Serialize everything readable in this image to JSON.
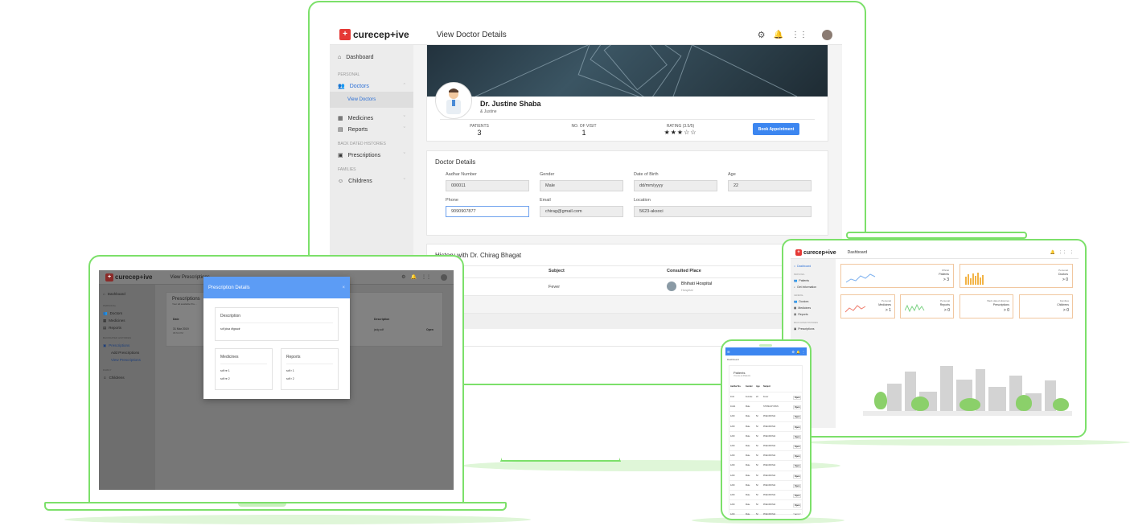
{
  "brand": {
    "name": "curecep+ive",
    "mark": "+"
  },
  "desktop": {
    "page_title": "View Doctor Details",
    "sidebar": {
      "dashboard": "Dashboard",
      "sec_personal": "PERSONAL",
      "doctors": "Doctors",
      "view_doctors": "View Doctors",
      "medicines": "Medicines",
      "reports": "Reports",
      "sec_backdated": "BACK DATED HISTORIES",
      "prescriptions": "Prescriptions",
      "sec_families": "FAMILIES",
      "childrens": "Childrens"
    },
    "profile": {
      "name": "Dr. Justine Shaba",
      "username": "& Justine",
      "patients_label": "PATIENTS",
      "patients_value": "3",
      "visits_label": "NO. OF VISIT",
      "visits_value": "1",
      "rating_label": "RATING (3.5/5)",
      "rating_stars": "★★★☆☆",
      "book_button": "Book Appointment"
    },
    "details": {
      "title": "Doctor Details",
      "aadhar_label": "Aadhar Number",
      "aadhar_value": "000011",
      "gender_label": "Gender",
      "gender_value": "Male",
      "dob_label": "Date of Birth",
      "dob_value": "dd/mm/yyyy",
      "age_label": "Age",
      "age_value": "22",
      "phone_label": "Phone",
      "phone_value": "9090907877",
      "email_label": "Email",
      "email_value": "chirag@gmail.com",
      "location_label": "Location",
      "location_value": "5623-aksoci"
    },
    "history": {
      "title": "History with Dr. Chirag Bhagat",
      "col_subject": "Subject",
      "col_place": "Consulted Place",
      "row_subject": "Fever",
      "row_place": "Bhihati Hospital",
      "row_place_sub": "Hospital"
    }
  },
  "laptop": {
    "page_title": "View Prescriptions",
    "sidebar": {
      "dashboard": "Dashboard",
      "sec_personal": "PERSONAL",
      "doctors": "Doctors",
      "medicines": "Medicines",
      "reports": "Reports",
      "sec_backdated": "BACKDATED HISTORIES",
      "prescriptions": "Prescriptions",
      "add_prescriptions": "Add Prescriptions",
      "view_prescriptions": "View Prescriptions",
      "sec_family": "FAMILY",
      "childrens": "Childrens"
    },
    "panel": {
      "title": "Prescriptions",
      "subtitle": "Your all available Pre...",
      "col_date": "Date",
      "col_description": "Description",
      "row_date": "31 Mar 2019",
      "row_time": "05:54 PM",
      "row_description": "jsdg sdf",
      "row_action": "Open"
    },
    "modal": {
      "title": "Prescription Details",
      "close": "×",
      "description_label": "Description",
      "description_value": "sdf jdsa dfgsadr",
      "medicines_label": "Medicines",
      "medicines": [
        "sdf re 1",
        "sdf re 2"
      ],
      "reports_label": "Reports",
      "reports": [
        "sdf r 1",
        "sdf r 2"
      ]
    }
  },
  "tablet": {
    "page_title": "Dashboard",
    "sidebar": {
      "dashboard": "Dashboard",
      "sec_personal": "PERSONAL",
      "patients": "Patients",
      "get_information": "Get Information",
      "sec_general": "GENERAL",
      "doctors": "Doctors",
      "medicines": "Medicines",
      "reports": "Reports",
      "sec_backdated": "BACK DATED HISTORIES",
      "prescriptions": "Prescriptions"
    },
    "cards": [
      {
        "line1": "Official",
        "line2": "Patients",
        "value": "> 3"
      },
      {
        "line1": "Personal",
        "line2": "Doctors",
        "value": "> 0"
      },
      {
        "line1": "Personal",
        "line2": "Medicines",
        "value": "> 1"
      },
      {
        "line1": "Personal",
        "line2": "Reports",
        "value": "> 0"
      },
      {
        "line1": "Back dated Histories",
        "line2": "Prescriptions",
        "value": "> 0"
      },
      {
        "line1": "Families",
        "line2": "Childrens",
        "value": "> 0"
      }
    ]
  },
  "phone": {
    "breadcrumb": "Dashboard",
    "panel_title": "Patients",
    "panel_subtitle": "You are at Patients",
    "columns": [
      "Aadhar No.",
      "Gender",
      "Age",
      "Subject"
    ],
    "rows": [
      [
        "1111",
        "Female",
        "22",
        "Fever",
        "Open"
      ],
      [
        "11111",
        "Male",
        "",
        "STOMACH PAIN",
        "Open"
      ],
      [
        "1200",
        "Male",
        "52",
        "PNEUMONIA",
        "Open"
      ],
      [
        "1200",
        "Male",
        "52",
        "PNEUMONIA",
        "Open"
      ],
      [
        "1200",
        "Male",
        "52",
        "PNEUMONIA",
        "Open"
      ],
      [
        "1200",
        "Male",
        "52",
        "PNEUMONIA",
        "Open"
      ],
      [
        "1200",
        "Male",
        "52",
        "PNEUMONIA",
        "Open"
      ],
      [
        "1200",
        "Male",
        "52",
        "PNEUMONIA",
        "Open"
      ],
      [
        "1200",
        "Male",
        "52",
        "PNEUMONIA",
        "Open"
      ],
      [
        "1200",
        "Male",
        "52",
        "PNEUMONIA",
        "Open"
      ],
      [
        "1200",
        "Male",
        "52",
        "PNEUMONIA",
        "Open"
      ],
      [
        "1200",
        "Male",
        "52",
        "PNEUMONIA",
        "Open"
      ],
      [
        "1200",
        "Male",
        "52",
        "PNEUMONIA",
        "Open"
      ]
    ]
  },
  "colors": {
    "accent": "#7ce06a",
    "brand_red": "#e53935",
    "primary_blue": "#3c86f0"
  }
}
